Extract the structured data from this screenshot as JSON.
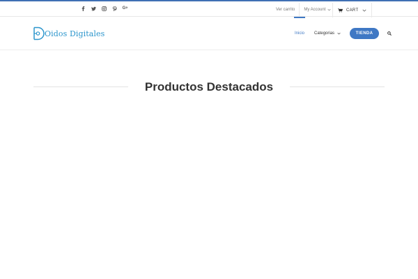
{
  "colors": {
    "accent": "#3f78c4",
    "logo": "#2b95cc",
    "top_accent": "#3f6fb4"
  },
  "topbar": {
    "social": [
      "facebook-icon",
      "twitter-icon",
      "instagram-icon",
      "pinterest-icon",
      "google-plus-icon"
    ],
    "google_plus_label": "G+",
    "links": {
      "ver_carrito": "Ver carrito",
      "my_account": "My Account"
    },
    "cart_label": "CART"
  },
  "header": {
    "logo_text": "Oidos Digitales",
    "nav": {
      "inicio": "Inicio",
      "categorias": "Categorias",
      "tienda": "TIENDA"
    }
  },
  "main": {
    "section_title": "Productos Destacados"
  }
}
